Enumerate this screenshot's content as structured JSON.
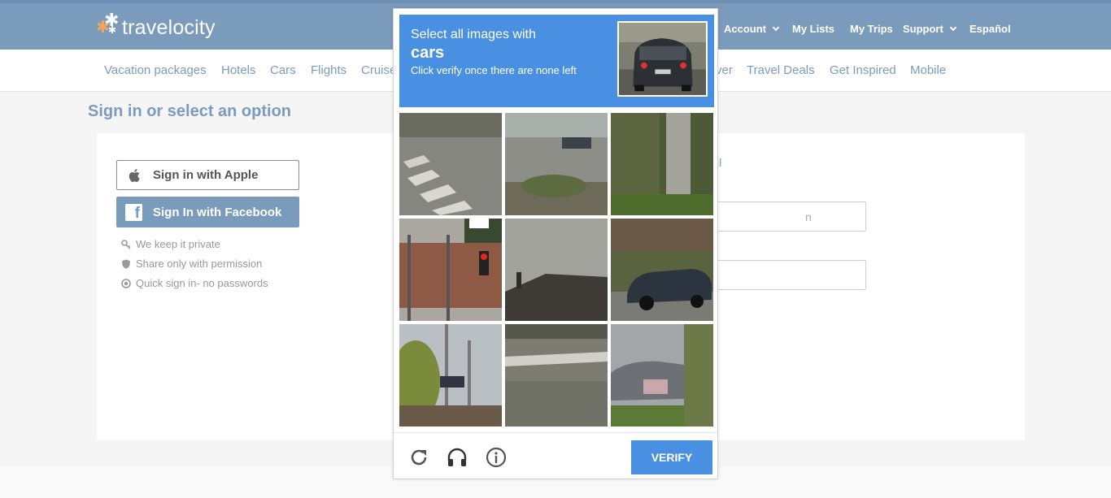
{
  "header": {
    "logo_text": "travelocity",
    "nav": [
      {
        "label": "Account",
        "has_dropdown": true
      },
      {
        "label": "My Lists",
        "has_dropdown": false
      },
      {
        "label": "My Trips",
        "has_dropdown": false
      },
      {
        "label": "Support",
        "has_dropdown": true
      },
      {
        "label": "Español",
        "has_dropdown": false
      }
    ]
  },
  "subnav": {
    "items": [
      "Vacation packages",
      "Hotels",
      "Cars",
      "Flights",
      "Cruise",
      "ver",
      "Travel Deals",
      "Get Inspired",
      "Mobile"
    ]
  },
  "page": {
    "title": "Sign in or select an option"
  },
  "signin": {
    "apple_label": "Sign in with Apple",
    "facebook_label": "Sign In with Facebook",
    "perks": [
      "We keep it private",
      "Share only with permission",
      "Quick sign in- no passwords"
    ],
    "email_link_fragment": "il",
    "field_fragment": "n"
  },
  "captcha": {
    "prompt_line1": "Select all images with",
    "prompt_target": "cars",
    "prompt_line3": "Click verify once there are none left",
    "verify_label": "VERIFY",
    "tiles": [
      "crosswalk",
      "parking lot with car",
      "tree trunk",
      "brick wall with traffic light",
      "rooftop",
      "parked car",
      "trees and light poles",
      "crosswalk",
      "car behind tree"
    ],
    "footer_icons": [
      "refresh-icon",
      "headphones-icon",
      "info-icon"
    ]
  },
  "colors": {
    "brand_blue": "#7b9bbd",
    "captcha_blue": "#4a90e2"
  }
}
